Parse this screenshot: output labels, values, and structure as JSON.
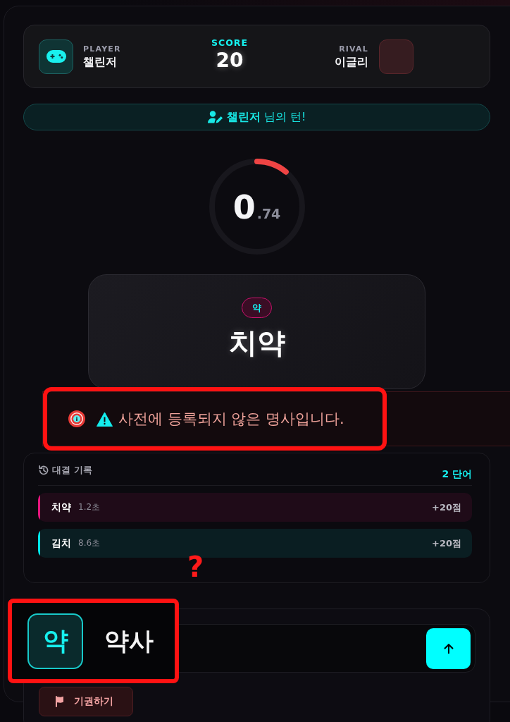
{
  "score_board": {
    "player": {
      "label": "PLAYER",
      "name": "챌린저"
    },
    "score": {
      "label": "SCORE",
      "value": "20"
    },
    "rival": {
      "label": "RIVAL",
      "name": "이글리"
    }
  },
  "turn_banner": {
    "text": "**챌린저** 님의 턴!"
  },
  "timer": {
    "whole": "0",
    "fraction": ".74",
    "level": 0.11
  },
  "word_card": {
    "badge": "약",
    "word": "치약"
  },
  "error_toast": {
    "message": "사전에 등록되지 않은 명사입니다.",
    "highlighted": true
  },
  "history": {
    "title": "대결 기록",
    "count": "2 단어",
    "rows": [
      {
        "word": "치약",
        "time": "1.2초",
        "points": "+20점",
        "color": "#e6157d"
      },
      {
        "word": "김치",
        "time": "8.6초",
        "points": "+20점",
        "color": "#00e5e8"
      }
    ]
  },
  "answer": {
    "start_letter": "약",
    "value": "약사",
    "highlighted": true
  },
  "surrender_button": {
    "label": "기권하기"
  },
  "annotation": {
    "text": "?"
  }
}
